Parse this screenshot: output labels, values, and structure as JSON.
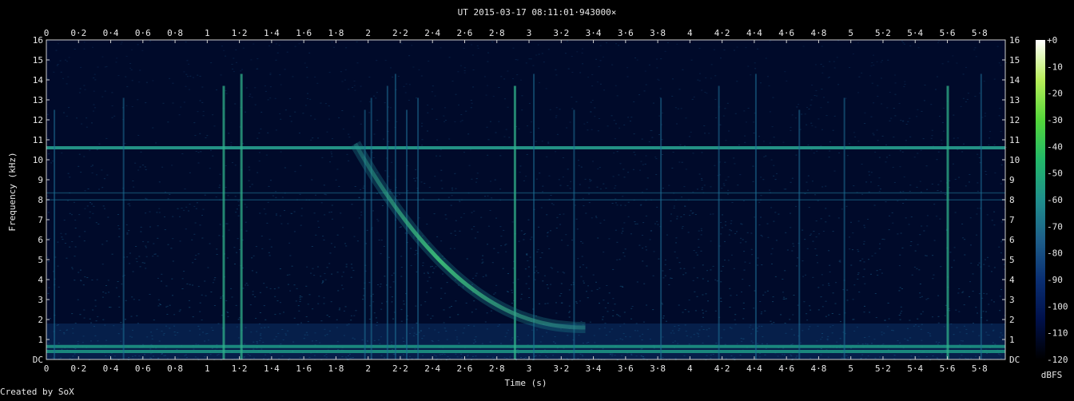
{
  "chart_data": {
    "type": "heatmap",
    "title": "UT 2015-03-17 08:11:01·943000×",
    "xlabel": "Time (s)",
    "ylabel": "Frequency (kHz)",
    "credit": "Created by SoX",
    "xlim": [
      0,
      5.96
    ],
    "ylim": [
      0,
      16
    ],
    "x_ticks": [
      "0",
      "0·2",
      "0·4",
      "0·6",
      "0·8",
      "1",
      "1·2",
      "1·4",
      "1·6",
      "1·8",
      "2",
      "2·2",
      "2·4",
      "2·6",
      "2·8",
      "3",
      "3·2",
      "3·4",
      "3·6",
      "3·8",
      "4",
      "4·2",
      "4·4",
      "4·6",
      "4·8",
      "5",
      "5·2",
      "5·4",
      "5·6",
      "5·8"
    ],
    "y_ticks": [
      "DC",
      "1",
      "2",
      "3",
      "4",
      "5",
      "6",
      "7",
      "8",
      "9",
      "10",
      "11",
      "12",
      "13",
      "14",
      "15",
      "16"
    ],
    "colorbar": {
      "label": "dBFS",
      "range": [
        -120,
        0
      ],
      "ticks": [
        "+0",
        "-10",
        "-20",
        "-30",
        "-40",
        "-50",
        "-60",
        "-70",
        "-80",
        "-90",
        "-100",
        "-110",
        "-120"
      ],
      "colors": [
        "#000000",
        "#00104a",
        "#0a2f73",
        "#1e5f8a",
        "#1f8f8c",
        "#22b869",
        "#54d63a",
        "#b8ee5a",
        "#ffffff"
      ]
    },
    "background_level_dbfs": -100,
    "features": {
      "hum_lines_khz": [
        0.4,
        0.65
      ],
      "tone_line_khz": 10.6,
      "faint_lines_khz": [
        8.0,
        8.35
      ],
      "whistler": {
        "t_start_s": 1.92,
        "f_start_khz": 10.8,
        "t_end_s": 3.35,
        "f_end_khz": 1.6
      },
      "sferics_s": [
        0.05,
        0.48,
        1.1,
        1.21,
        1.98,
        2.02,
        2.12,
        2.17,
        2.24,
        2.31,
        2.91,
        3.03,
        3.28,
        3.82,
        4.18,
        4.41,
        4.68,
        4.96,
        5.6,
        5.81
      ]
    }
  }
}
